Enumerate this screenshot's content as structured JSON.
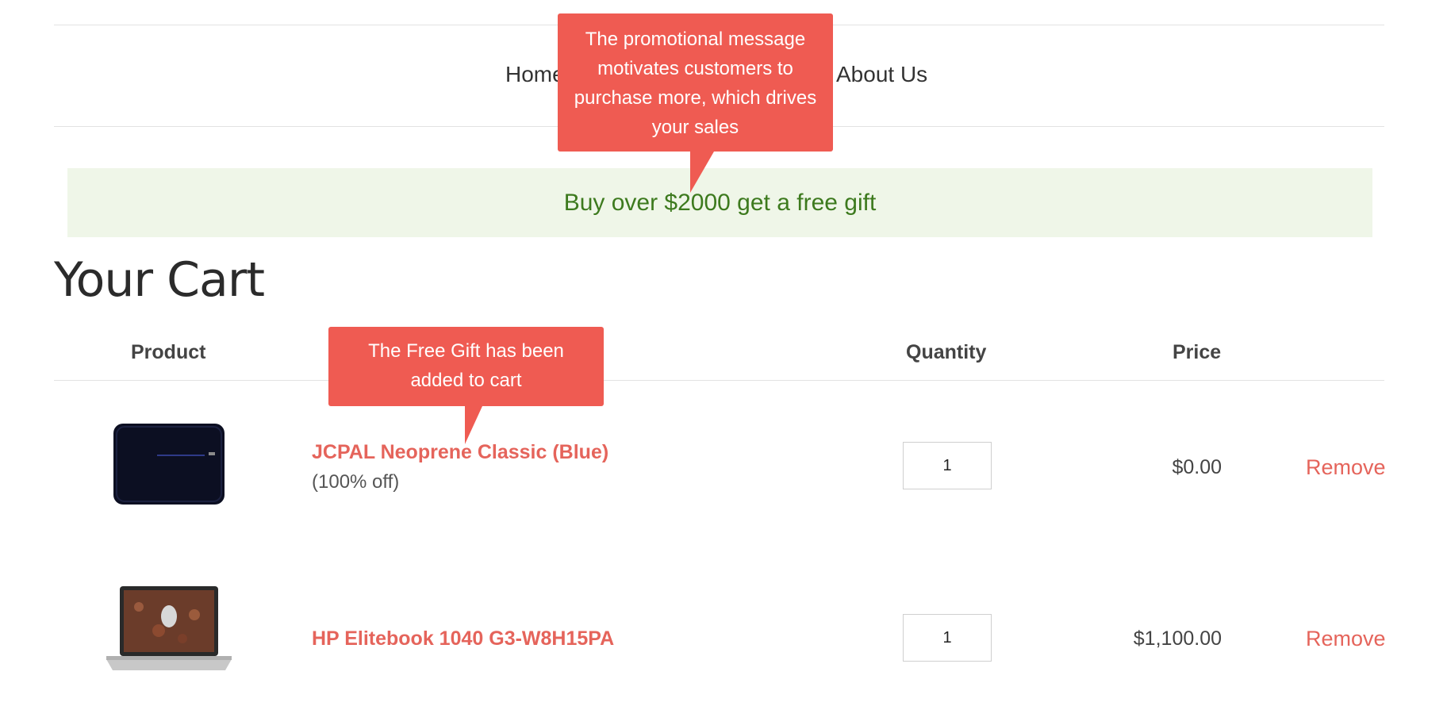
{
  "nav": {
    "items": [
      {
        "label": "Home"
      },
      {
        "label": "About Us"
      }
    ]
  },
  "promo_bar": {
    "text": "Buy over $2000 get a free gift"
  },
  "cart": {
    "title": "Your Cart",
    "columns": {
      "product": "Product",
      "quantity": "Quantity",
      "price": "Price"
    },
    "items": [
      {
        "name": "JCPAL Neoprene Classic (Blue)",
        "discount": "(100% off)",
        "quantity": "1",
        "price": "$0.00",
        "remove_label": "Remove",
        "image": "laptop-sleeve-image"
      },
      {
        "name": "HP Elitebook 1040 G3-W8H15PA",
        "discount": "",
        "quantity": "1",
        "price": "$1,100.00",
        "remove_label": "Remove",
        "image": "laptop-image"
      }
    ]
  },
  "tooltips": {
    "promo_note": "The promotional message motivates customers to purchase more, which drives your sales",
    "gift_note": "The Free Gift has been added to cart"
  },
  "colors": {
    "accent": "#e5645b",
    "tooltip_bg": "#ef5b52",
    "promo_bg": "#eff6e8",
    "promo_text": "#3d7a1e"
  }
}
